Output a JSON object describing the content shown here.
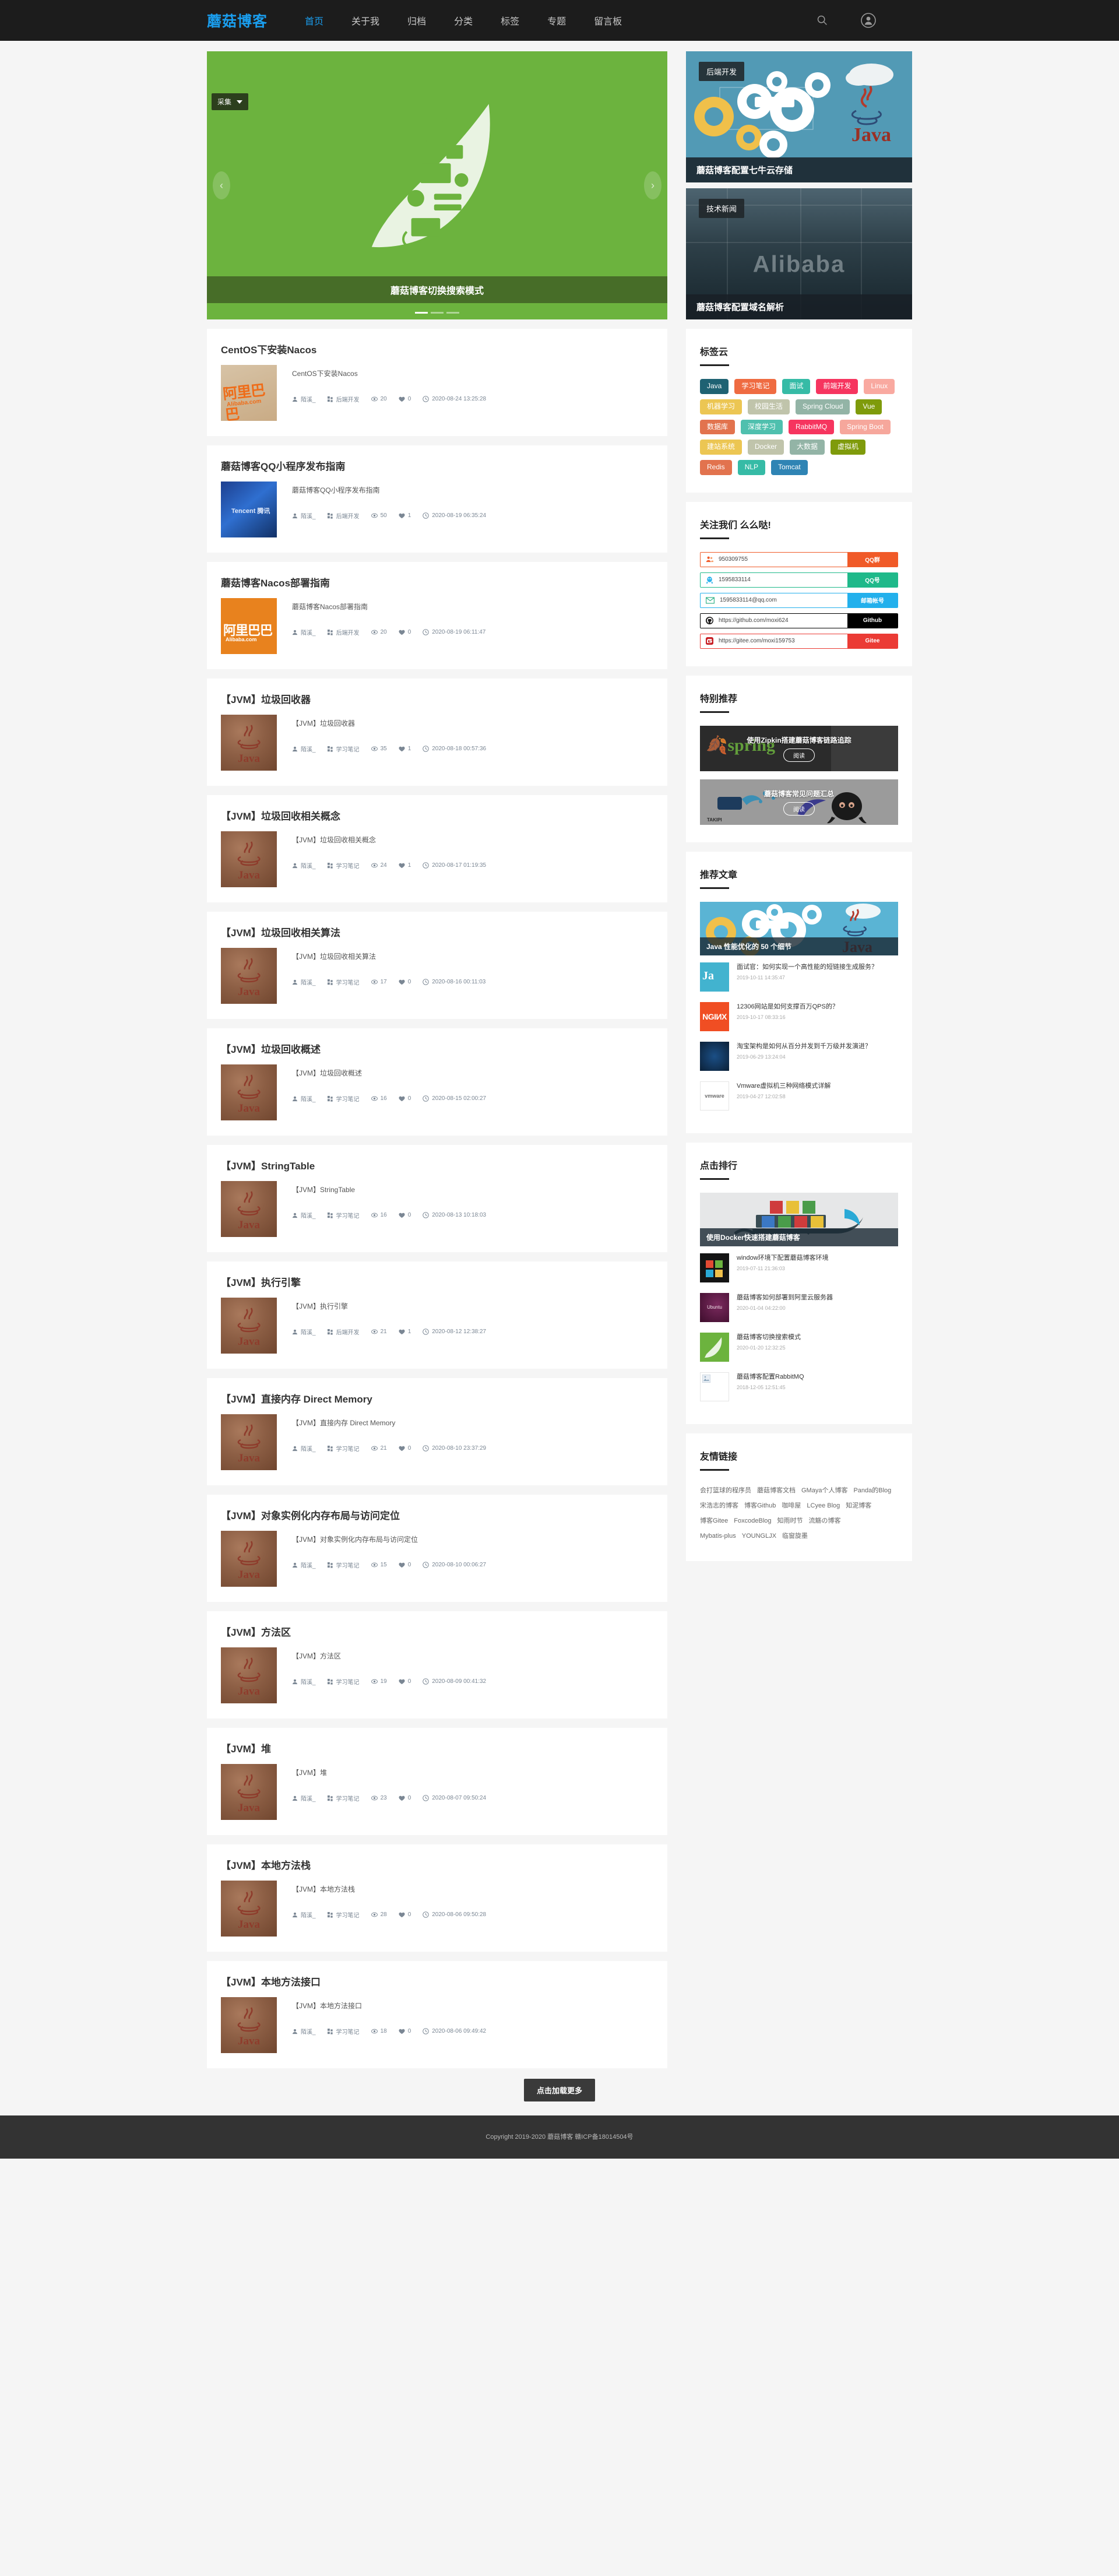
{
  "header": {
    "brand": "蘑菇博客",
    "nav": [
      {
        "label": "首页",
        "active": true
      },
      {
        "label": "关于我",
        "active": false
      },
      {
        "label": "归档",
        "active": false
      },
      {
        "label": "分类",
        "active": false
      },
      {
        "label": "标签",
        "active": false
      },
      {
        "label": "专题",
        "active": false
      },
      {
        "label": "留言板",
        "active": false
      }
    ],
    "search_icon": "search-icon",
    "user_icon": "user-avatar-icon"
  },
  "carousel": {
    "badge": "采集",
    "caption": "蘑菇博客切换搜索模式",
    "prev": "‹",
    "next": "›"
  },
  "banner_side": [
    {
      "category": "后端开发",
      "title": "蘑菇博客配置七牛云存储",
      "art": "gears"
    },
    {
      "category": "技术新闻",
      "title": "蘑菇博客配置域名解析",
      "art": "building",
      "word": "Alibaba"
    }
  ],
  "articles": [
    {
      "title": "CentOS下安装Nacos",
      "summary": "CentOS下安装Nacos",
      "author": "陌溪_",
      "category": "后端开发",
      "views": "20",
      "likes": "0",
      "date": "2020-08-24 13:25:28",
      "thumb": "alibaba"
    },
    {
      "title": "蘑菇博客QQ小程序发布指南",
      "summary": "蘑菇博客QQ小程序发布指南",
      "author": "陌溪_",
      "category": "后端开发",
      "views": "50",
      "likes": "1",
      "date": "2020-08-19 06:35:24",
      "thumb": "tencent"
    },
    {
      "title": "蘑菇博客Nacos部署指南",
      "summary": "蘑菇博客Nacos部署指南",
      "author": "陌溪_",
      "category": "后端开发",
      "views": "20",
      "likes": "0",
      "date": "2020-08-19 06:11:47",
      "thumb": "orange"
    },
    {
      "title": "【JVM】垃圾回收器",
      "summary": "【JVM】垃圾回收器",
      "author": "陌溪_",
      "category": "学习笔记",
      "views": "35",
      "likes": "1",
      "date": "2020-08-18 00:57:36",
      "thumb": "java"
    },
    {
      "title": "【JVM】垃圾回收相关概念",
      "summary": "【JVM】垃圾回收相关概念",
      "author": "陌溪_",
      "category": "学习笔记",
      "views": "24",
      "likes": "1",
      "date": "2020-08-17 01:19:35",
      "thumb": "java"
    },
    {
      "title": "【JVM】垃圾回收相关算法",
      "summary": "【JVM】垃圾回收相关算法",
      "author": "陌溪_",
      "category": "学习笔记",
      "views": "17",
      "likes": "0",
      "date": "2020-08-16 00:11:03",
      "thumb": "java"
    },
    {
      "title": "【JVM】垃圾回收概述",
      "summary": "【JVM】垃圾回收概述",
      "author": "陌溪_",
      "category": "学习笔记",
      "views": "16",
      "likes": "0",
      "date": "2020-08-15 02:00:27",
      "thumb": "java"
    },
    {
      "title": "【JVM】StringTable",
      "summary": "【JVM】StringTable",
      "author": "陌溪_",
      "category": "学习笔记",
      "views": "16",
      "likes": "0",
      "date": "2020-08-13 10:18:03",
      "thumb": "java"
    },
    {
      "title": "【JVM】执行引擎",
      "summary": "【JVM】执行引擎",
      "author": "陌溪_",
      "category": "后端开发",
      "views": "21",
      "likes": "1",
      "date": "2020-08-12 12:38:27",
      "thumb": "java"
    },
    {
      "title": "【JVM】直接内存 Direct Memory",
      "summary": "【JVM】直接内存 Direct Memory",
      "author": "陌溪_",
      "category": "学习笔记",
      "views": "21",
      "likes": "0",
      "date": "2020-08-10 23:37:29",
      "thumb": "java"
    },
    {
      "title": "【JVM】对象实例化内存布局与访问定位",
      "summary": "【JVM】对象实例化内存布局与访问定位",
      "author": "陌溪_",
      "category": "学习笔记",
      "views": "15",
      "likes": "0",
      "date": "2020-08-10 00:06:27",
      "thumb": "java"
    },
    {
      "title": "【JVM】方法区",
      "summary": "【JVM】方法区",
      "author": "陌溪_",
      "category": "学习笔记",
      "views": "19",
      "likes": "0",
      "date": "2020-08-09 00:41:32",
      "thumb": "java"
    },
    {
      "title": "【JVM】堆",
      "summary": "【JVM】堆",
      "author": "陌溪_",
      "category": "学习笔记",
      "views": "23",
      "likes": "0",
      "date": "2020-08-07 09:50:24",
      "thumb": "java"
    },
    {
      "title": "【JVM】本地方法栈",
      "summary": "【JVM】本地方法栈",
      "author": "陌溪_",
      "category": "学习笔记",
      "views": "28",
      "likes": "0",
      "date": "2020-08-06 09:50:28",
      "thumb": "java"
    },
    {
      "title": "【JVM】本地方法接口",
      "summary": "【JVM】本地方法接口",
      "author": "陌溪_",
      "category": "学习笔记",
      "views": "18",
      "likes": "0",
      "date": "2020-08-06 09:49:42",
      "thumb": "java"
    }
  ],
  "load_more": "点击加载更多",
  "sidebar": {
    "tagcloud": {
      "title": "标签云",
      "tags": [
        {
          "label": "Java",
          "color": "#1f6273"
        },
        {
          "label": "学习笔记",
          "color": "#ef6b41"
        },
        {
          "label": "面试",
          "color": "#36bba6"
        },
        {
          "label": "前端开发",
          "color": "#f6355f"
        },
        {
          "label": "Linux",
          "color": "#f9a9a0"
        },
        {
          "label": "机器学习",
          "color": "#ecc653"
        },
        {
          "label": "校园生活",
          "color": "#c0c4ab"
        },
        {
          "label": "Spring Cloud",
          "color": "#93b4a6"
        },
        {
          "label": "Vue",
          "color": "#7f9b0b"
        },
        {
          "label": "数据库",
          "color": "#e2734e"
        },
        {
          "label": "深度学习",
          "color": "#4fc0ae"
        },
        {
          "label": "RabbitMQ",
          "color": "#f6355f"
        },
        {
          "label": "Spring Boot",
          "color": "#f6a79c"
        },
        {
          "label": "建站系统",
          "color": "#ecc653"
        },
        {
          "label": "Docker",
          "color": "#c0c4ab"
        },
        {
          "label": "大数据",
          "color": "#93b4a6"
        },
        {
          "label": "虚拟机",
          "color": "#7f9b0b"
        },
        {
          "label": "Redis",
          "color": "#e2734e"
        },
        {
          "label": "NLP",
          "color": "#36bba6"
        },
        {
          "label": "Tomcat",
          "color": "#2f84b4"
        }
      ]
    },
    "contact": {
      "title": "关注我们 么么哒!",
      "rows": [
        {
          "icon": "qq-group-icon",
          "value": "950309755",
          "button": "QQ群",
          "color": "#f05a28",
          "border": "#f05a28"
        },
        {
          "icon": "qq-penguin-icon",
          "value": "1595833114",
          "button": "QQ号",
          "color": "#1fb98a",
          "border": "#1fb98a"
        },
        {
          "icon": "mail-icon",
          "value": "1595833114@qq.com",
          "button": "邮箱帐号",
          "color": "#23b0ec",
          "border": "#23b0ec"
        },
        {
          "icon": "github-icon",
          "value": "https://github.com/moxi624",
          "button": "Github",
          "color": "#000000",
          "border": "#000000"
        },
        {
          "icon": "gitee-icon",
          "value": "https://gitee.com/moxi159753",
          "button": "Gitee",
          "color": "#eb3b35",
          "border": "#eb3b35"
        }
      ]
    },
    "featured": {
      "title": "特别推荐",
      "items": [
        {
          "title": "使用Zipkin搭建蘑菇博客链路追踪",
          "button": "阅读",
          "art": "spring"
        },
        {
          "title": "蘑菇博客常见问题汇总",
          "button": "阅读",
          "art": "octo",
          "watermark": "TAKIPI"
        }
      ]
    },
    "recommended": {
      "title": "推荐文章",
      "hero": {
        "title": "Java 性能优化的 50 个细节",
        "art": "gears"
      },
      "items": [
        {
          "title": "面试官：如何实现一个高性能的短链接生成服务？",
          "date": "2019-10-11 14:35:47",
          "thumb": "jq"
        },
        {
          "title": "12306网站是如何支撑百万QPS的？",
          "date": "2019-10-17 08:33:16",
          "thumb": "nginx"
        },
        {
          "title": "淘宝架构是如何从百分并发到千万级并发演进？",
          "date": "2019-06-29 13:24:04",
          "thumb": "taobao"
        },
        {
          "title": "Vmware虚拟机三种网络模式详解",
          "date": "2019-04-27 12:02:58",
          "thumb": "vmware"
        }
      ]
    },
    "ranking": {
      "title": "点击排行",
      "hero": {
        "title": "使用Docker快速搭建蘑菇博客",
        "art": "docker"
      },
      "items": [
        {
          "title": "window环境下配置蘑菇博客环境",
          "date": "2019-07-11 21:36:03",
          "thumb": "win"
        },
        {
          "title": "蘑菇博客如何部署到阿里云服务器",
          "date": "2020-01-04 04:22:00",
          "thumb": "ubuntu"
        },
        {
          "title": "蘑菇博客切换搜索模式",
          "date": "2020-01-20 12:32:25",
          "thumb": "green"
        },
        {
          "title": "蘑菇博客配置RabbitMQ",
          "date": "2018-12-05 12:51:45",
          "thumb": "blank"
        }
      ]
    },
    "links": {
      "title": "友情链接",
      "items": [
        "会打篮球的程序员",
        "蘑菇博客文档",
        "GMaya个人博客",
        "Panda的Blog",
        "宋浩志的博客",
        "博客Github",
        "咖啡屋",
        "LCyee Blog",
        "知泥博客",
        "博客Gitee",
        "FoxcodeBlog",
        "知雨时节",
        "流觞の博客",
        "Mybatis-plus",
        "YOUNGLJX",
        "临窗旋墨"
      ]
    }
  },
  "footer": {
    "copyright": "Copyright 2019-2020 蘑菇博客  赣ICP备18014504号"
  }
}
